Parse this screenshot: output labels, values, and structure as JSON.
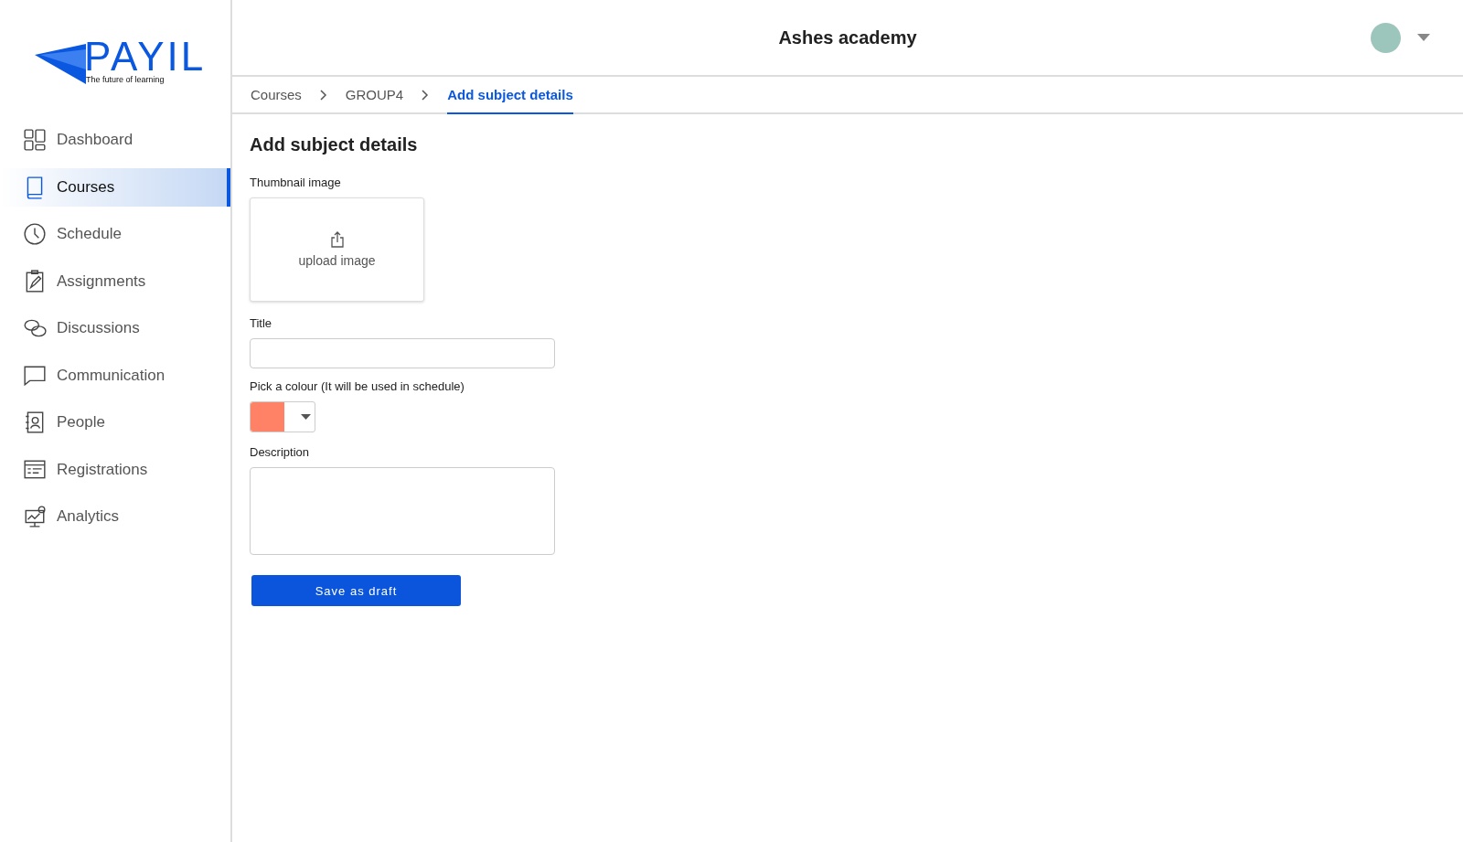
{
  "logo": {
    "name": "PAYIL",
    "tagline": "The future of learning"
  },
  "sidebar": {
    "items": [
      {
        "label": "Dashboard",
        "selected": false
      },
      {
        "label": "Courses",
        "selected": true
      },
      {
        "label": "Schedule",
        "selected": false
      },
      {
        "label": "Assignments",
        "selected": false
      },
      {
        "label": "Discussions",
        "selected": false
      },
      {
        "label": "Communication",
        "selected": false
      },
      {
        "label": "People",
        "selected": false
      },
      {
        "label": "Registrations",
        "selected": false
      },
      {
        "label": "Analytics",
        "selected": false
      }
    ]
  },
  "header": {
    "title": "Ashes academy"
  },
  "breadcrumbs": [
    {
      "label": "Courses",
      "selected": false
    },
    {
      "label": "GROUP4",
      "selected": false
    },
    {
      "label": "Add subject details",
      "selected": true
    }
  ],
  "form": {
    "heading": "Add subject details",
    "thumbnail": {
      "label": "Thumbnail image",
      "button": "upload image"
    },
    "title_field": {
      "label": "Title"
    },
    "colour_picker": {
      "label": "Pick a colour (It will be used in schedule)",
      "color": "#ff8266"
    },
    "description_field": {
      "label": "Description"
    },
    "save_button": "Save as draft"
  }
}
